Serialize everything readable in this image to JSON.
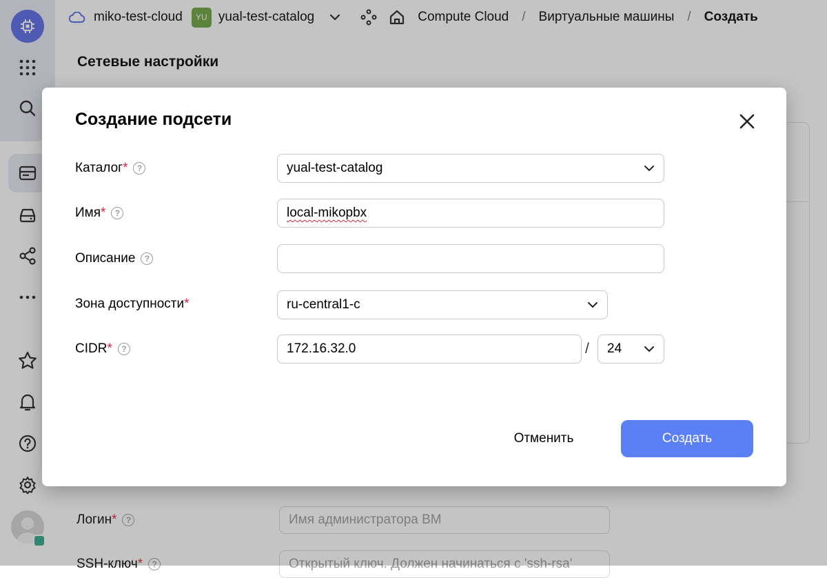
{
  "header": {
    "cloud_name": "miko-test-cloud",
    "catalog_badge": "YU",
    "catalog_name": "yual-test-catalog",
    "breadcrumbs": [
      "Compute Cloud",
      "Виртуальные машины",
      "Создать"
    ],
    "separator": "/"
  },
  "background_page": {
    "section_title": "Сетевые настройки",
    "login_label": "Логин",
    "login_placeholder": "Имя администратора ВМ",
    "ssh_label": "SSH-ключ",
    "ssh_placeholder": "Открытый ключ. Должен начинаться с 'ssh-rsa'"
  },
  "modal": {
    "title": "Создание подсети",
    "required_mark": "*",
    "help_glyph": "?",
    "fields": {
      "catalog": {
        "label": "Каталог",
        "value": "yual-test-catalog"
      },
      "name": {
        "label": "Имя",
        "value": "local-mikopbx"
      },
      "description": {
        "label": "Описание",
        "value": ""
      },
      "zone": {
        "label": "Зона доступности",
        "value": "ru-central1-c"
      },
      "cidr": {
        "label": "CIDR",
        "address": "172.16.32.0",
        "separator": "/",
        "prefix": "24"
      }
    },
    "cancel_label": "Отменить",
    "create_label": "Создать"
  },
  "colors": {
    "accent": "#5b80f5",
    "logo": "#5867e6",
    "required": "#e0203e",
    "catalog_badge": "#6aa33c"
  }
}
